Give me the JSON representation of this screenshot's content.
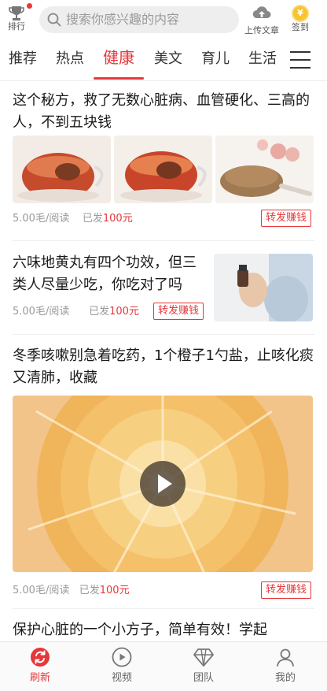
{
  "header": {
    "rank_label": "排行",
    "search_placeholder": "搜索你感兴趣的内容",
    "upload_label": "上传文章",
    "sign_label": "签到",
    "sign_coin_symbol": "¥"
  },
  "tabs": [
    {
      "label": "推荐",
      "active": false
    },
    {
      "label": "热点",
      "active": false
    },
    {
      "label": "健康",
      "active": true
    },
    {
      "label": "美文",
      "active": false
    },
    {
      "label": "育儿",
      "active": false
    },
    {
      "label": "生活",
      "active": false
    }
  ],
  "articles": [
    {
      "title": "这个秘方，救了无数心脏病、血管硬化、三高的人，不到五块钱",
      "price": "5.00毛/阅读",
      "paid_prefix": "已发",
      "paid_amount": "100元",
      "share_label": "转发赚钱"
    },
    {
      "title": "六味地黄丸有四个功效，但三类人尽量少吃，你吃对了吗",
      "price": "5.00毛/阅读",
      "paid_prefix": "已发",
      "paid_amount": "100元",
      "share_label": "转发赚钱"
    },
    {
      "title": "冬季咳嗽别急着吃药，1个橙子1勺盐，止咳化痰又清肺，收藏",
      "price": "5.00毛/阅读",
      "paid_prefix": "已发",
      "paid_amount": "100元",
      "share_label": "转发赚钱"
    },
    {
      "title": "保护心脏的一个小方子，简单有效！学起"
    }
  ],
  "bottom_nav": [
    {
      "label": "刷新",
      "icon": "refresh-icon",
      "active": true
    },
    {
      "label": "视频",
      "icon": "play-circle-icon",
      "active": false
    },
    {
      "label": "团队",
      "icon": "diamond-icon",
      "active": false
    },
    {
      "label": "我的",
      "icon": "user-icon",
      "active": false
    }
  ],
  "colors": {
    "accent": "#e5383b",
    "text": "#1a1a1a",
    "muted": "#999999"
  }
}
